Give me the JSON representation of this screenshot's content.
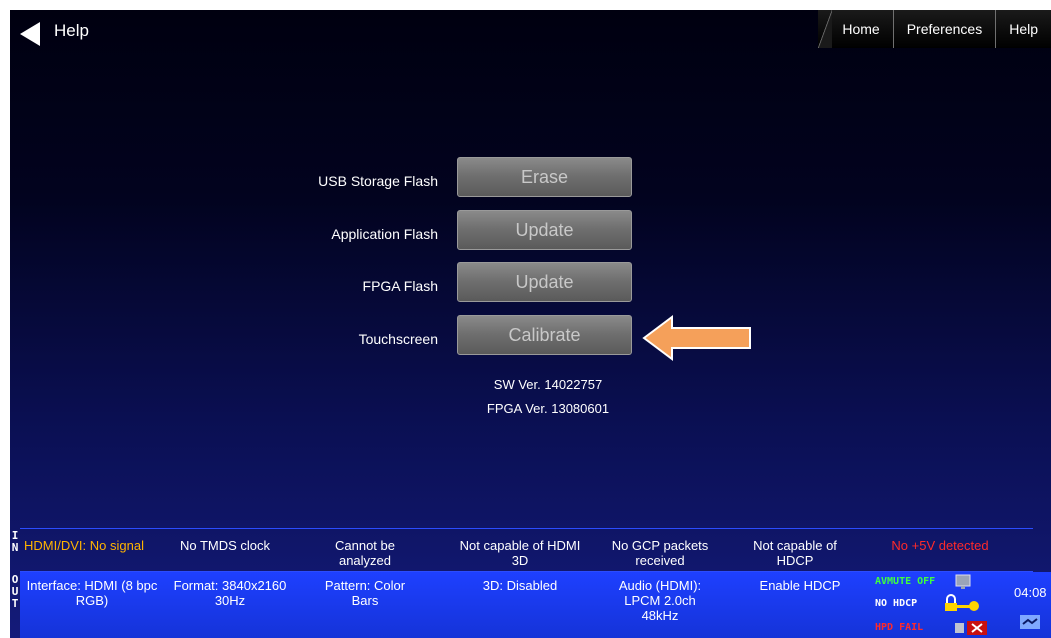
{
  "header": {
    "title": "Help",
    "tabs": [
      {
        "label": "Home"
      },
      {
        "label": "Preferences"
      },
      {
        "label": "Help"
      }
    ]
  },
  "rows": [
    {
      "label": "USB Storage Flash",
      "button": "Erase"
    },
    {
      "label": "Application Flash",
      "button": "Update"
    },
    {
      "label": "FPGA Flash",
      "button": "Update"
    },
    {
      "label": "Touchscreen",
      "button": "Calibrate"
    }
  ],
  "versions": {
    "sw": "SW Ver. 14022757",
    "fpga": "FPGA Ver. 13080601"
  },
  "status_in": {
    "side_label": [
      "I",
      "N"
    ],
    "cells": [
      {
        "text": "HDMI/DVI: No signal",
        "color": "#ffb300"
      },
      {
        "text": "No TMDS clock",
        "color": "#ffffff"
      },
      {
        "text": "Cannot be analyzed",
        "color": "#ffffff"
      },
      {
        "text": "Not capable of HDMI 3D",
        "color": "#ffffff"
      },
      {
        "text": "No GCP packets received",
        "color": "#ffffff"
      },
      {
        "text": "Not capable of HDCP",
        "color": "#ffffff"
      },
      {
        "text": "No +5V detected",
        "color": "#ff2a2a"
      }
    ]
  },
  "status_out": {
    "side_label": [
      "O",
      "U",
      "T"
    ],
    "cells": [
      {
        "text": "Interface: HDMI (8 bpc RGB)"
      },
      {
        "text": "Format: 3840x2160 30Hz"
      },
      {
        "text": "Pattern: Color Bars"
      },
      {
        "text": "3D: Disabled"
      },
      {
        "text": "Audio (HDMI): LPCM 2.0ch 48kHz"
      },
      {
        "text": "Enable HDCP"
      }
    ],
    "indicators": {
      "avmute": "AVMUTE OFF",
      "hdcp": "NO HDCP",
      "hpd": "HPD FAIL"
    },
    "time": "04:08"
  },
  "colors": {
    "arrow": "#f5a05a",
    "accent": "#1e40ff"
  }
}
